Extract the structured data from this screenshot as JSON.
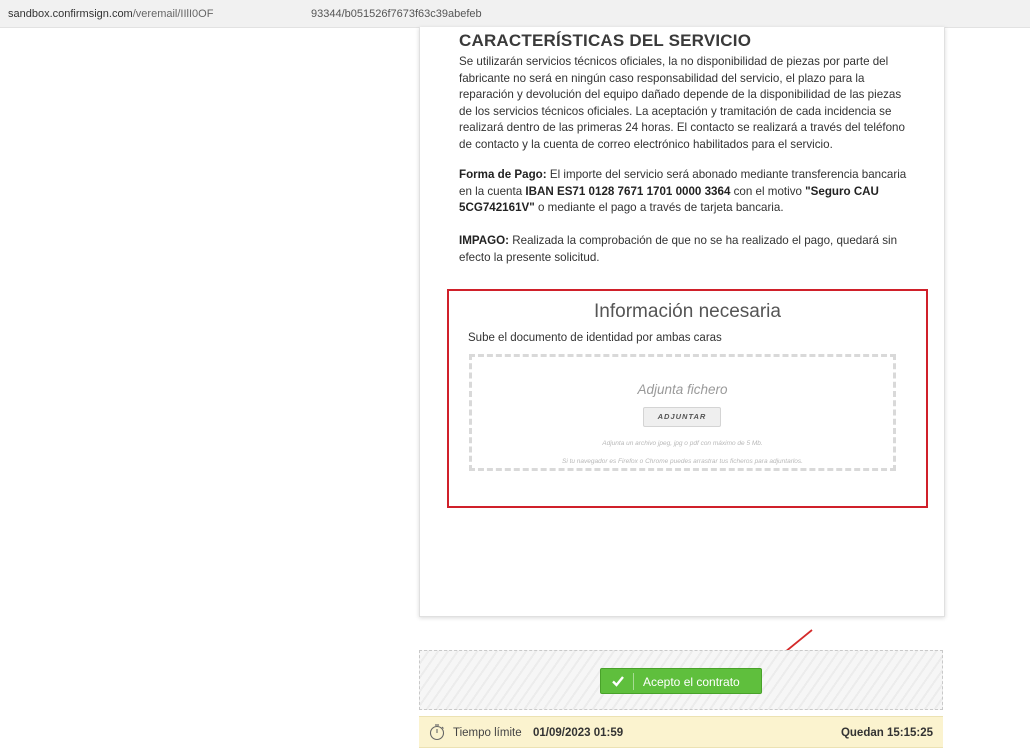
{
  "urlbar": {
    "host": "sandbox.confirmsign.com",
    "path": "/veremail/IIlI0OF",
    "hash": "93344/b051526f7673f63c39abefeb"
  },
  "document": {
    "heading": "CARACTERÍSTICAS DEL SERVICIO",
    "paragraph1": "Se utilizarán servicios técnicos oficiales, la no disponibilidad de piezas por parte del fabricante no será en ningún caso responsabilidad del servicio, el plazo para la reparación y devolución del equipo dañado depende de la disponibilidad de las piezas de los servicios técnicos oficiales. La aceptación y tramitación de cada incidencia se realizará dentro de las primeras 24 horas. El contacto se realizará a través del teléfono de contacto y la cuenta de correo electrónico habilitados para el servicio.",
    "payment": {
      "label": "Forma de Pago:",
      "text_a": " El importe del servicio será abonado mediante transferencia bancaria en la cuenta ",
      "iban": "IBAN ES71 0128 7671 1701 0000 3364",
      "text_b": " con el motivo ",
      "motive": "\"Seguro CAU 5CG742161V\"",
      "text_c": " o mediante el pago a través de tarjeta bancaria."
    },
    "impago": {
      "label": "IMPAGO:",
      "text": " Realizada la comprobación de que no se ha realizado el pago, quedará sin efecto la presente solicitud."
    }
  },
  "info_box": {
    "title": "Información necesaria",
    "subtitle": "Sube el documento de identidad por ambas caras",
    "dropzone_title": "Adjunta fichero",
    "attach_button": "ADJUNTAR",
    "hint1": "Adjunta un archivo jpeg, jpg o pdf con máximo de 5 Mb.",
    "hint2": "Si tu navegador es Firefox o Chrome puedes arrastrar tus ficheros para adjuntarlos."
  },
  "accept": {
    "button_label": "Acepto el contrato"
  },
  "timer": {
    "label": "Tiempo límite",
    "deadline": "01/09/2023 01:59",
    "remaining": "Quedan 15:15:25"
  },
  "colors": {
    "highlight_border": "#d0202a",
    "accept_green": "#5fbf3d",
    "timer_bg": "#fbf3cf",
    "arrow_red": "#d42a2a"
  }
}
